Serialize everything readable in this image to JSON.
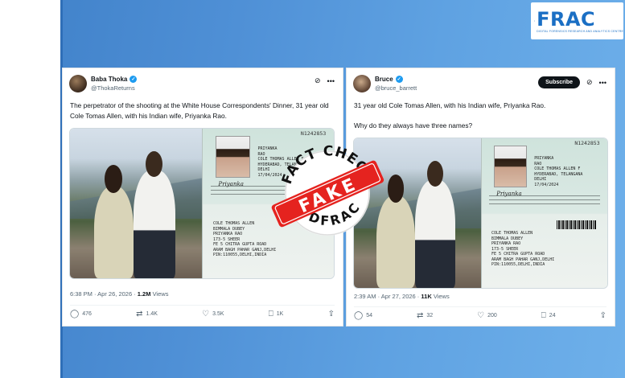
{
  "logo": {
    "word": "FRAC",
    "tagline": "DIGITAL FORENSICS RESEARCH AND ANALYTICS CENTRE"
  },
  "stamp": {
    "top_text": "FACT CHECK",
    "main_text": "FAKE",
    "bottom_text": "DFRAC",
    "color": "#e5231f"
  },
  "tweets": [
    {
      "name": "Baba Thoka",
      "handle": "@ThokaReturns",
      "text": "The perpetrator of the shooting at the White House Correspondents' Dinner, 31 year old Cole Tomas Allen, with his Indian wife, Priyanka Rao.",
      "time": "6:38 PM · Apr 26, 2026 · ",
      "views_count": "1.2M",
      "views_label": " Views",
      "replies": "476",
      "reposts": "1.4K",
      "likes": "3.5K",
      "bookmarks": "1K",
      "passport_number": "N1242853",
      "passport_name": "PRIYANKA\nRAO\nCOLE THOMAS ALLEN F\nHYDERABAD, TELANGANA\nDELHI\n17/04/2024",
      "passport_sign": "Priyanka",
      "passport_back": "COLE THOMAS ALLEN\nBIMMALA DUBEY\nPRIYANKA RAO\n173-5 SHEER\nFE 5 CHITRA GUPTA ROAD\nARAM BAGH PAHAR GANJ,DELHI\nPIN:110055,DELHI,INDIA"
    },
    {
      "name": "Bruce",
      "handle": "@bruce_barrett",
      "subscribe": "Subscribe",
      "text_line1": "31 year old Cole Tomas Allen, with his Indian wife, Priyanka Rao.",
      "text_line2": "Why do they always have three names?",
      "time": "2:39 AM · Apr 27, 2026 · ",
      "views_count": "11K",
      "views_label": " Views",
      "replies": "54",
      "reposts": "32",
      "likes": "200",
      "bookmarks": "24",
      "passport_number": "N1242853",
      "passport_name": "PRIYANKA\nRAO\nCOLE THOMAS ALLEN F\nHYDERABAD, TELANGANA\nDELHI\n17/04/2024",
      "passport_sign": "Priyanka",
      "passport_back": "COLE THOMAS ALLEN\nBIMMALA DUBEY\nPRIYANKA RAO\n173-5 SHEER\nFE 5 CHITRA GUPTA ROAD\nARAM BAGH PAHAR GANJ,DELHI\nPIN:110055,DELHI,INDIA"
    }
  ]
}
